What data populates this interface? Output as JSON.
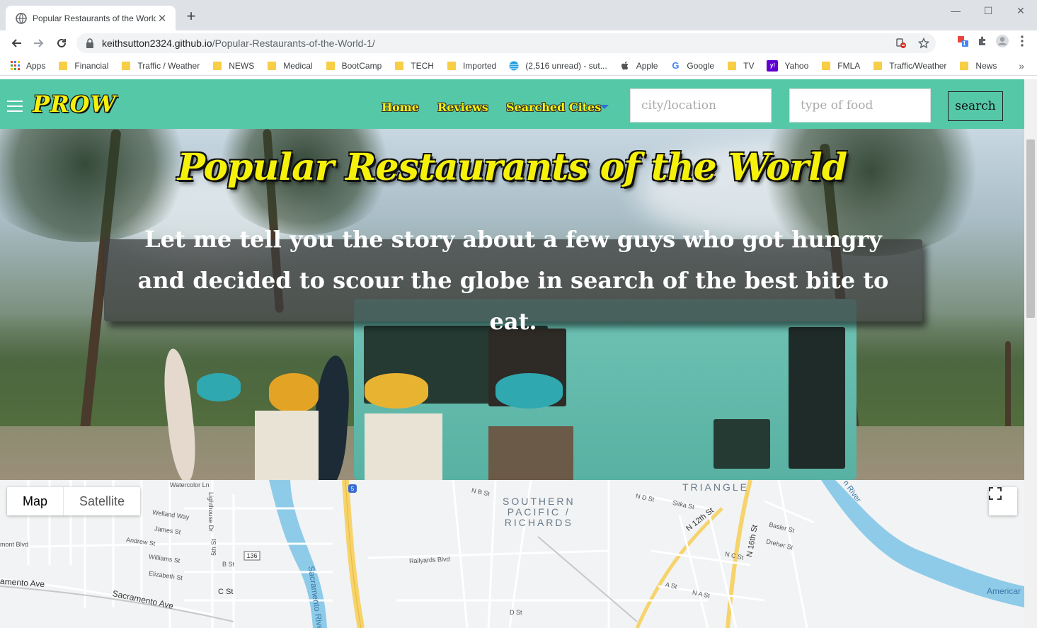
{
  "browser": {
    "tab_title": "Popular Restaurants of the World",
    "url_host": "keithsutton2324.github.io",
    "url_path": "/Popular-Restaurants-of-the-World-1/",
    "bookmarks": [
      "Apps",
      "Financial",
      "Traffic / Weather",
      "NEWS",
      "Medical",
      "BootCamp",
      "TECH",
      "Imported",
      "(2,516 unread) - sut...",
      "Apple",
      "Google",
      "TV",
      "Yahoo",
      "FMLA",
      "Traffic/Weather",
      "News"
    ],
    "ext_badge": "1"
  },
  "navbar": {
    "logo": "PROW",
    "links": [
      "Home",
      "Reviews",
      "Searched Cites"
    ],
    "city_placeholder": "city/location",
    "food_placeholder": "type of food",
    "search_label": "search"
  },
  "hero": {
    "title": "Popular Restaurants of the World",
    "story": "Let me tell you the story about a few guys who got hungry and decided to scour the globe in search of the best bite to eat."
  },
  "map": {
    "type_map": "Map",
    "type_satellite": "Satellite",
    "district_1": "TRIANGLE",
    "district_2_lines": [
      "SOUTHERN",
      "PACIFIC /",
      "RICHARDS"
    ],
    "streets": {
      "sacramento_ave": "Sacramento Ave",
      "amento_ave": "amento Ave",
      "sacramento_river": "Sacramento Rive",
      "lighthouse_dr": "Lighthouse Dr",
      "fifth_st": "5th St",
      "railyards_blvd": "Railyards Blvd",
      "n_12th_st": "N 12th St",
      "n_16th_st": "N 16th St",
      "america": "Americar",
      "river": "n River",
      "watercolor_ln": "Watercolor Ln",
      "welland_way": "Welland Way",
      "james_st": "James St",
      "andrew_st": "Andrew St",
      "williams_st": "Williams St",
      "elizabeth_st": "Elizabeth St",
      "mont_blvd": "mont Blvd",
      "b_st": "B St",
      "c_st": "C St",
      "d_st": "D St",
      "n_b_st": "N B St",
      "n_d_st": "N D St",
      "sitka_st": "Sitka St",
      "basler_st": "Basler St",
      "dreher_st": "Dreher St",
      "n_c_st": "N C St",
      "a_st": "A St",
      "n_a_st": "N A St",
      "route_5": "5",
      "route_136": "136"
    }
  }
}
